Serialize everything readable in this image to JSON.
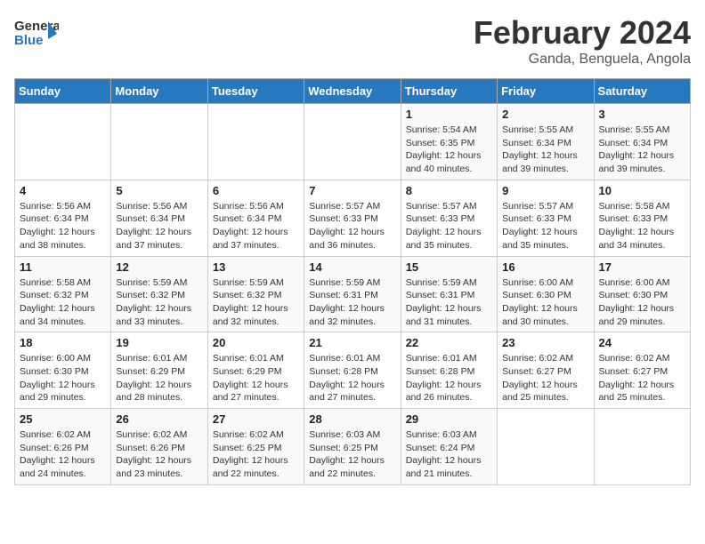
{
  "logo": {
    "text_general": "General",
    "text_blue": "Blue"
  },
  "title": "February 2024",
  "subtitle": "Ganda, Benguela, Angola",
  "days_of_week": [
    "Sunday",
    "Monday",
    "Tuesday",
    "Wednesday",
    "Thursday",
    "Friday",
    "Saturday"
  ],
  "weeks": [
    [
      {
        "day": "",
        "sunrise": "",
        "sunset": "",
        "daylight": ""
      },
      {
        "day": "",
        "sunrise": "",
        "sunset": "",
        "daylight": ""
      },
      {
        "day": "",
        "sunrise": "",
        "sunset": "",
        "daylight": ""
      },
      {
        "day": "",
        "sunrise": "",
        "sunset": "",
        "daylight": ""
      },
      {
        "day": "1",
        "sunrise": "Sunrise: 5:54 AM",
        "sunset": "Sunset: 6:35 PM",
        "daylight": "Daylight: 12 hours and 40 minutes."
      },
      {
        "day": "2",
        "sunrise": "Sunrise: 5:55 AM",
        "sunset": "Sunset: 6:34 PM",
        "daylight": "Daylight: 12 hours and 39 minutes."
      },
      {
        "day": "3",
        "sunrise": "Sunrise: 5:55 AM",
        "sunset": "Sunset: 6:34 PM",
        "daylight": "Daylight: 12 hours and 39 minutes."
      }
    ],
    [
      {
        "day": "4",
        "sunrise": "Sunrise: 5:56 AM",
        "sunset": "Sunset: 6:34 PM",
        "daylight": "Daylight: 12 hours and 38 minutes."
      },
      {
        "day": "5",
        "sunrise": "Sunrise: 5:56 AM",
        "sunset": "Sunset: 6:34 PM",
        "daylight": "Daylight: 12 hours and 37 minutes."
      },
      {
        "day": "6",
        "sunrise": "Sunrise: 5:56 AM",
        "sunset": "Sunset: 6:34 PM",
        "daylight": "Daylight: 12 hours and 37 minutes."
      },
      {
        "day": "7",
        "sunrise": "Sunrise: 5:57 AM",
        "sunset": "Sunset: 6:33 PM",
        "daylight": "Daylight: 12 hours and 36 minutes."
      },
      {
        "day": "8",
        "sunrise": "Sunrise: 5:57 AM",
        "sunset": "Sunset: 6:33 PM",
        "daylight": "Daylight: 12 hours and 35 minutes."
      },
      {
        "day": "9",
        "sunrise": "Sunrise: 5:57 AM",
        "sunset": "Sunset: 6:33 PM",
        "daylight": "Daylight: 12 hours and 35 minutes."
      },
      {
        "day": "10",
        "sunrise": "Sunrise: 5:58 AM",
        "sunset": "Sunset: 6:33 PM",
        "daylight": "Daylight: 12 hours and 34 minutes."
      }
    ],
    [
      {
        "day": "11",
        "sunrise": "Sunrise: 5:58 AM",
        "sunset": "Sunset: 6:32 PM",
        "daylight": "Daylight: 12 hours and 34 minutes."
      },
      {
        "day": "12",
        "sunrise": "Sunrise: 5:59 AM",
        "sunset": "Sunset: 6:32 PM",
        "daylight": "Daylight: 12 hours and 33 minutes."
      },
      {
        "day": "13",
        "sunrise": "Sunrise: 5:59 AM",
        "sunset": "Sunset: 6:32 PM",
        "daylight": "Daylight: 12 hours and 32 minutes."
      },
      {
        "day": "14",
        "sunrise": "Sunrise: 5:59 AM",
        "sunset": "Sunset: 6:31 PM",
        "daylight": "Daylight: 12 hours and 32 minutes."
      },
      {
        "day": "15",
        "sunrise": "Sunrise: 5:59 AM",
        "sunset": "Sunset: 6:31 PM",
        "daylight": "Daylight: 12 hours and 31 minutes."
      },
      {
        "day": "16",
        "sunrise": "Sunrise: 6:00 AM",
        "sunset": "Sunset: 6:30 PM",
        "daylight": "Daylight: 12 hours and 30 minutes."
      },
      {
        "day": "17",
        "sunrise": "Sunrise: 6:00 AM",
        "sunset": "Sunset: 6:30 PM",
        "daylight": "Daylight: 12 hours and 29 minutes."
      }
    ],
    [
      {
        "day": "18",
        "sunrise": "Sunrise: 6:00 AM",
        "sunset": "Sunset: 6:30 PM",
        "daylight": "Daylight: 12 hours and 29 minutes."
      },
      {
        "day": "19",
        "sunrise": "Sunrise: 6:01 AM",
        "sunset": "Sunset: 6:29 PM",
        "daylight": "Daylight: 12 hours and 28 minutes."
      },
      {
        "day": "20",
        "sunrise": "Sunrise: 6:01 AM",
        "sunset": "Sunset: 6:29 PM",
        "daylight": "Daylight: 12 hours and 27 minutes."
      },
      {
        "day": "21",
        "sunrise": "Sunrise: 6:01 AM",
        "sunset": "Sunset: 6:28 PM",
        "daylight": "Daylight: 12 hours and 27 minutes."
      },
      {
        "day": "22",
        "sunrise": "Sunrise: 6:01 AM",
        "sunset": "Sunset: 6:28 PM",
        "daylight": "Daylight: 12 hours and 26 minutes."
      },
      {
        "day": "23",
        "sunrise": "Sunrise: 6:02 AM",
        "sunset": "Sunset: 6:27 PM",
        "daylight": "Daylight: 12 hours and 25 minutes."
      },
      {
        "day": "24",
        "sunrise": "Sunrise: 6:02 AM",
        "sunset": "Sunset: 6:27 PM",
        "daylight": "Daylight: 12 hours and 25 minutes."
      }
    ],
    [
      {
        "day": "25",
        "sunrise": "Sunrise: 6:02 AM",
        "sunset": "Sunset: 6:26 PM",
        "daylight": "Daylight: 12 hours and 24 minutes."
      },
      {
        "day": "26",
        "sunrise": "Sunrise: 6:02 AM",
        "sunset": "Sunset: 6:26 PM",
        "daylight": "Daylight: 12 hours and 23 minutes."
      },
      {
        "day": "27",
        "sunrise": "Sunrise: 6:02 AM",
        "sunset": "Sunset: 6:25 PM",
        "daylight": "Daylight: 12 hours and 22 minutes."
      },
      {
        "day": "28",
        "sunrise": "Sunrise: 6:03 AM",
        "sunset": "Sunset: 6:25 PM",
        "daylight": "Daylight: 12 hours and 22 minutes."
      },
      {
        "day": "29",
        "sunrise": "Sunrise: 6:03 AM",
        "sunset": "Sunset: 6:24 PM",
        "daylight": "Daylight: 12 hours and 21 minutes."
      },
      {
        "day": "",
        "sunrise": "",
        "sunset": "",
        "daylight": ""
      },
      {
        "day": "",
        "sunrise": "",
        "sunset": "",
        "daylight": ""
      }
    ]
  ]
}
